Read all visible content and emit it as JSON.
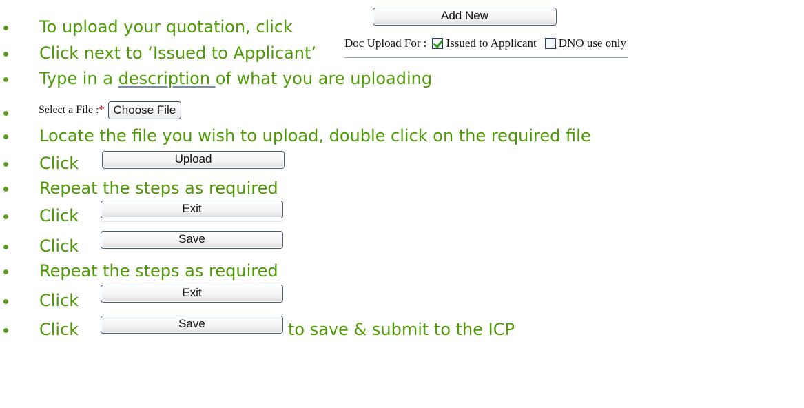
{
  "steps": {
    "s1": {
      "text": "To upload your quotation, click",
      "button": "Add New"
    },
    "s2": {
      "text": "Click next to ‘Issued to Applicant’"
    },
    "doc_upload": {
      "label": "Doc Upload For :",
      "opt1": "Issued to Applicant",
      "opt1_checked": true,
      "opt2": "DNO use only",
      "opt2_checked": false
    },
    "s3": {
      "pre": "Type in a ",
      "link": "description ",
      "post": "of what you are uploading"
    },
    "file": {
      "label": "Select a File :",
      "required_mark": "*",
      "button": "Choose File"
    },
    "s5": {
      "text": "Locate the file you wish to upload, double click on the required file"
    },
    "s6": {
      "text": "Click",
      "button": "Upload"
    },
    "s7": {
      "text": "Repeat the steps as required"
    },
    "s8": {
      "text": "Click",
      "button": "Exit"
    },
    "s9": {
      "text": "Click",
      "button": "Save"
    },
    "s10": {
      "text": "Repeat the steps as required"
    },
    "s11": {
      "text": "Click",
      "button": "Exit"
    },
    "s12": {
      "text": "Click",
      "button": "Save",
      "post": "to save & submit to the ICP"
    }
  },
  "colors": {
    "text": "#4e9a06",
    "bullet": "#5a9c1e",
    "required": "#d00000"
  }
}
